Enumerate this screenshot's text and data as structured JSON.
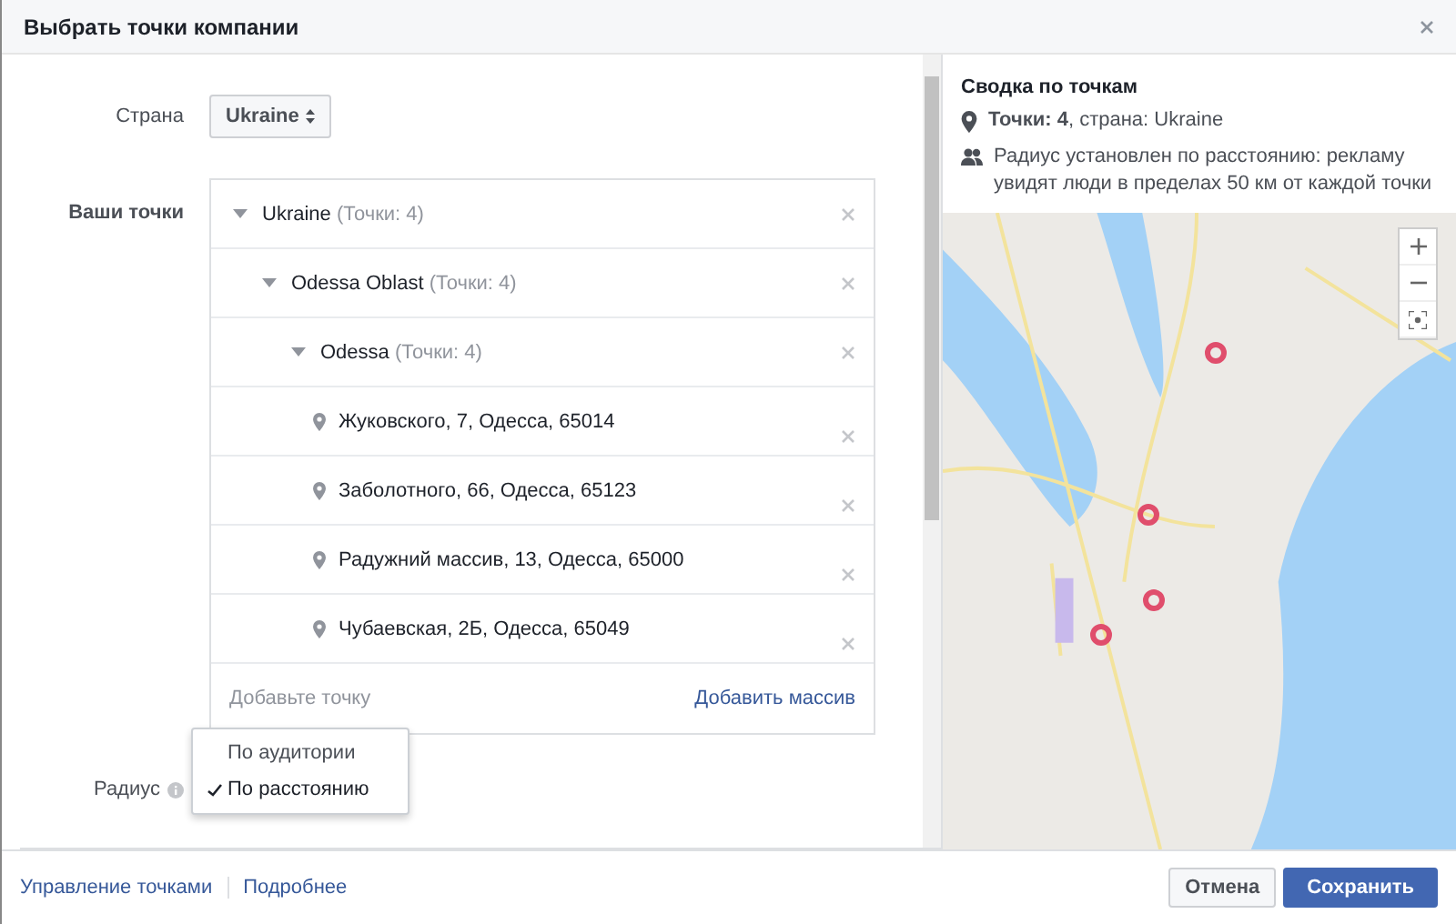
{
  "window": {
    "title": "Выбрать точки компании"
  },
  "form": {
    "country_label": "Страна",
    "country_value": "Ukraine",
    "places_label": "Ваши точки",
    "tree": [
      {
        "name": "Ukraine",
        "count": "(Точки: 4)",
        "expanded": true,
        "children": [
          {
            "name": "Odessa Oblast",
            "count": "(Точки: 4)",
            "expanded": true,
            "children": [
              {
                "name": "Odessa",
                "count": "(Точки: 4)",
                "expanded": true,
                "children": [
                  {
                    "address": "Жуковского, 7, Одесса, 65014"
                  },
                  {
                    "address": "Заболотного, 66, Одесса, 65123"
                  },
                  {
                    "address": "Радужний массив, 13, Одесса, 65000"
                  },
                  {
                    "address": "Чубаевская, 2Б, Одесса, 65049"
                  }
                ]
              }
            ]
          }
        ]
      }
    ],
    "add_placeholder": "Добавьте точку",
    "add_bulk": "Добавить массив",
    "radius_label": "Радиус",
    "radius_menu": [
      {
        "label": "По аудитории",
        "selected": false
      },
      {
        "label": "По расстоянию",
        "selected": true
      }
    ]
  },
  "summary": {
    "title": "Сводка по точкам",
    "points": "**Точки: 4**, страна: Ukraine",
    "radius": "Радиус установлен по расстоянию: рекламу увидят люди в пределах 50 км от каждой точки"
  },
  "footer": {
    "links": [
      "Управление точками",
      "Подробнее"
    ],
    "cancel": "Отмена",
    "save": "Сохранить"
  }
}
